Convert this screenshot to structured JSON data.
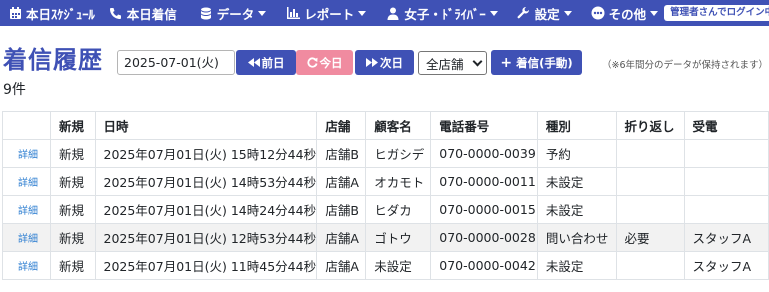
{
  "nav": {
    "items": [
      {
        "label": "本日ｽｹｼﾞｭｰﾙ",
        "icon": "calendar-icon",
        "has_caret": false
      },
      {
        "label": "本日着信",
        "icon": "phone-icon",
        "has_caret": false
      },
      {
        "label": "データ",
        "icon": "database-icon",
        "has_caret": true
      },
      {
        "label": "レポート",
        "icon": "bar-chart-icon",
        "has_caret": true
      },
      {
        "label": "女子・ﾄﾞﾗｲﾊﾞｰ",
        "icon": "user-icon",
        "has_caret": true
      },
      {
        "label": "設定",
        "icon": "wrench-icon",
        "has_caret": true
      },
      {
        "label": "その他",
        "icon": "ellipsis-icon",
        "has_caret": true
      }
    ],
    "admin_badge": "管理者さんでログイン中"
  },
  "page": {
    "title": "着信履歴",
    "count": "9件"
  },
  "controls": {
    "date": "2025-07-01(火)",
    "prev_label": "前日",
    "today_label": "今日",
    "next_label": "次日",
    "store_selected": "全店舗",
    "add_label": "着信(手動)",
    "note": "（※6年間分のデータが保持されます）"
  },
  "table": {
    "headers": [
      "",
      "新規",
      "日時",
      "店舗",
      "顧客名",
      "電話番号",
      "種別",
      "折り返し",
      "受電"
    ],
    "detail_label": "詳細",
    "rows": [
      {
        "new": "新規",
        "datetime": "2025年07月01日(火) 15時12分44秒",
        "store": "店舗B",
        "customer": "ヒガシデ",
        "phone": "070-0000-0039",
        "type": "予約",
        "callback": "",
        "receiver": ""
      },
      {
        "new": "新規",
        "datetime": "2025年07月01日(火) 14時53分44秒",
        "store": "店舗A",
        "customer": "オカモト",
        "phone": "070-0000-0011",
        "type": "未設定",
        "callback": "",
        "receiver": ""
      },
      {
        "new": "新規",
        "datetime": "2025年07月01日(火) 14時24分44秒",
        "store": "店舗B",
        "customer": "ヒダカ",
        "phone": "070-0000-0015",
        "type": "未設定",
        "callback": "",
        "receiver": ""
      },
      {
        "new": "新規",
        "datetime": "2025年07月01日(火) 12時53分44秒",
        "store": "店舗A",
        "customer": "ゴトウ",
        "phone": "070-0000-0028",
        "type": "問い合わせ",
        "callback": "必要",
        "receiver": "スタッフA"
      },
      {
        "new": "新規",
        "datetime": "2025年07月01日(火) 11時45分44秒",
        "store": "店舗A",
        "customer": "未設定",
        "phone": "070-0000-0042",
        "type": "未設定",
        "callback": "",
        "receiver": "スタッフA"
      }
    ]
  }
}
